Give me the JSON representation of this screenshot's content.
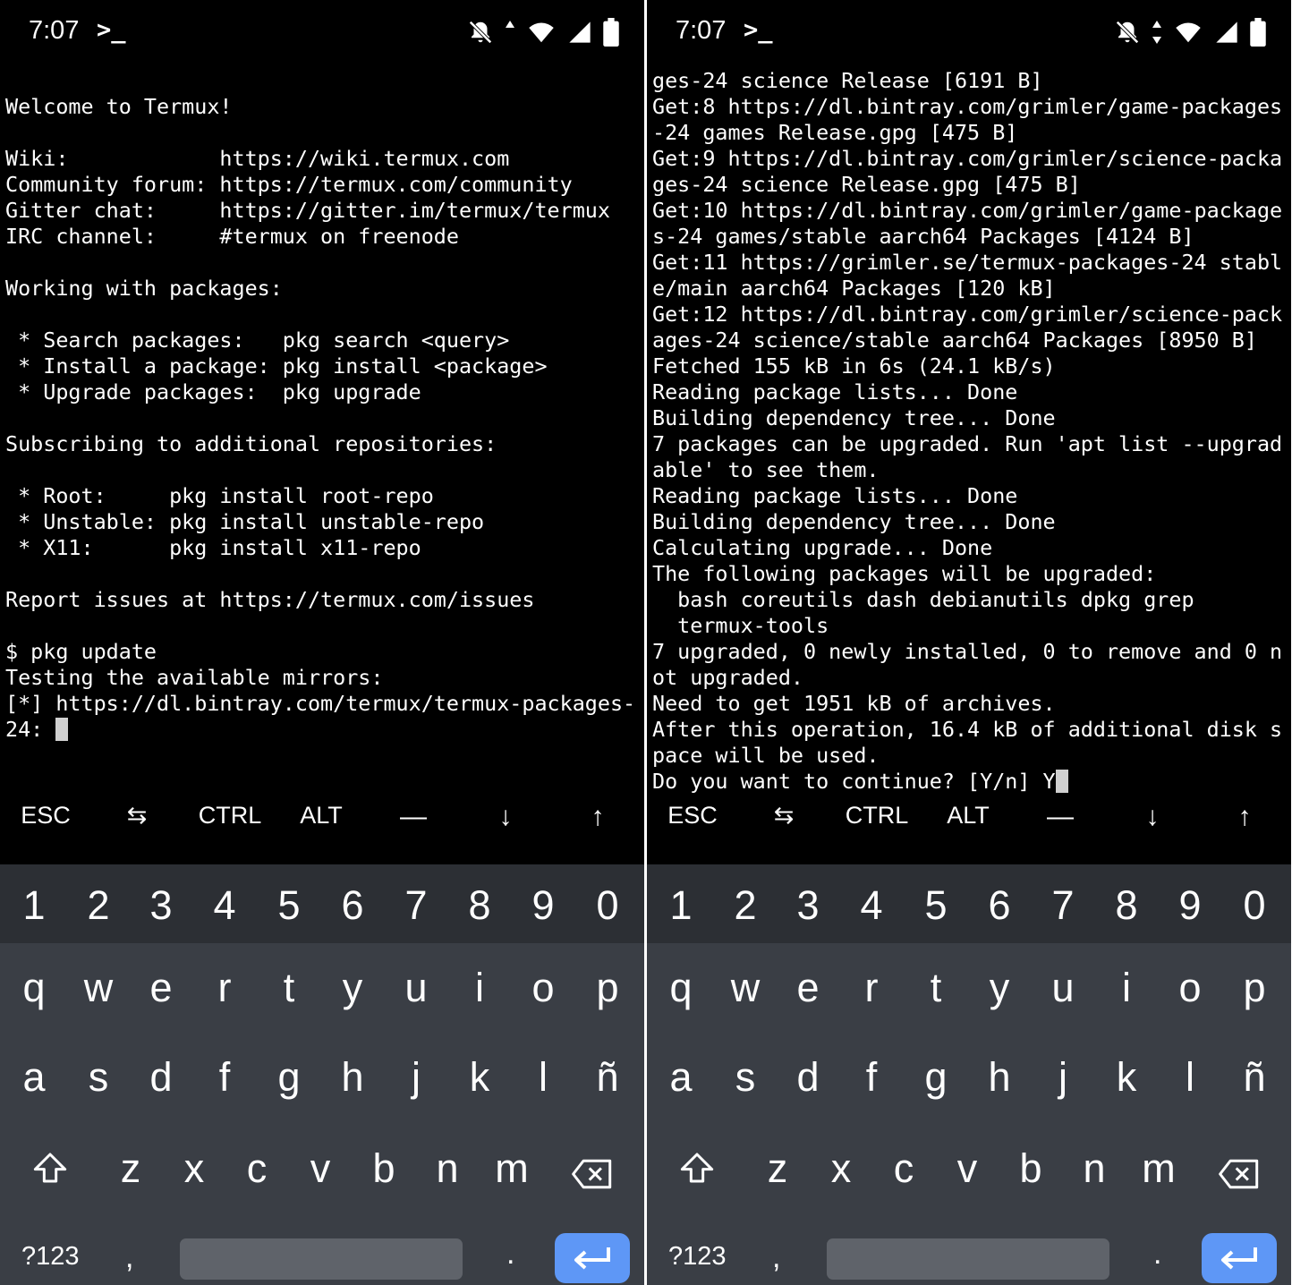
{
  "left": {
    "status": {
      "time": "7:07",
      "prompt_icon": "terminal-prompt-icon"
    },
    "terminal_lines": [
      "",
      "Welcome to Termux!",
      "",
      "Wiki:            https://wiki.termux.com",
      "Community forum: https://termux.com/community",
      "Gitter chat:     https://gitter.im/termux/termux",
      "IRC channel:     #termux on freenode",
      "",
      "Working with packages:",
      "",
      " * Search packages:   pkg search <query>",
      " * Install a package: pkg install <package>",
      " * Upgrade packages:  pkg upgrade",
      "",
      "Subscribing to additional repositories:",
      "",
      " * Root:     pkg install root-repo",
      " * Unstable: pkg install unstable-repo",
      " * X11:      pkg install x11-repo",
      "",
      "Report issues at https://termux.com/issues",
      "",
      "$ pkg update",
      "Testing the available mirrors:",
      "[*] https://dl.bintray.com/termux/termux-packages-",
      "24: "
    ]
  },
  "right": {
    "status": {
      "time": "7:07",
      "prompt_icon": "terminal-prompt-icon"
    },
    "terminal_lines": [
      "ges-24 science Release [6191 B]",
      "Get:8 https://dl.bintray.com/grimler/game-packages",
      "-24 games Release.gpg [475 B]",
      "Get:9 https://dl.bintray.com/grimler/science-packa",
      "ges-24 science Release.gpg [475 B]",
      "Get:10 https://dl.bintray.com/grimler/game-package",
      "s-24 games/stable aarch64 Packages [4124 B]",
      "Get:11 https://grimler.se/termux-packages-24 stabl",
      "e/main aarch64 Packages [120 kB]",
      "Get:12 https://dl.bintray.com/grimler/science-pack",
      "ages-24 science/stable aarch64 Packages [8950 B]",
      "Fetched 155 kB in 6s (24.1 kB/s)",
      "Reading package lists... Done",
      "Building dependency tree... Done",
      "7 packages can be upgraded. Run 'apt list --upgrad",
      "able' to see them.",
      "Reading package lists... Done",
      "Building dependency tree... Done",
      "Calculating upgrade... Done",
      "The following packages will be upgraded:",
      "  bash coreutils dash debianutils dpkg grep",
      "  termux-tools",
      "7 upgraded, 0 newly installed, 0 to remove and 0 n",
      "ot upgraded.",
      "Need to get 1951 kB of archives.",
      "After this operation, 16.4 kB of additional disk s",
      "pace will be used.",
      "Do you want to continue? [Y/n] Y"
    ]
  },
  "extra_keys": [
    "ESC",
    "⇆",
    "CTRL",
    "ALT",
    "—",
    "↓",
    "↑"
  ],
  "keyboard": {
    "numbers": [
      "1",
      "2",
      "3",
      "4",
      "5",
      "6",
      "7",
      "8",
      "9",
      "0"
    ],
    "row1": [
      "q",
      "w",
      "e",
      "r",
      "t",
      "y",
      "u",
      "i",
      "o",
      "p"
    ],
    "row2": [
      "a",
      "s",
      "d",
      "f",
      "g",
      "h",
      "j",
      "k",
      "l",
      "ñ"
    ],
    "row3": [
      "z",
      "x",
      "c",
      "v",
      "b",
      "n",
      "m"
    ],
    "symbols_label": "?123",
    "comma": ",",
    "period": "."
  },
  "icons": [
    "do-not-disturb-icon",
    "data-arrows-icon",
    "wifi-icon",
    "signal-icon",
    "battery-icon",
    "shift-icon",
    "backspace-icon",
    "enter-icon"
  ],
  "colors": {
    "terminal_bg": "#000000",
    "keyboard_bg": "#3a3e45",
    "number_row_bg": "#2c2f34",
    "enter_key": "#5e97f6",
    "space_key": "#5f636a"
  }
}
